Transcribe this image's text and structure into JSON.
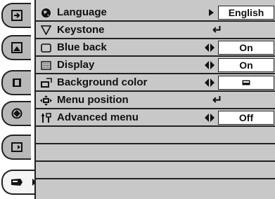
{
  "menu": {
    "tabs": [
      {
        "icon": "input-icon"
      },
      {
        "icon": "picture-adjust-icon"
      },
      {
        "icon": "screen-icon"
      },
      {
        "icon": "image-select-icon"
      },
      {
        "icon": "sound-icon"
      },
      {
        "icon": "setting-icon",
        "active": true
      }
    ],
    "items": [
      {
        "label": "Language",
        "icon": "globe-icon",
        "control": "submenu",
        "value": "English"
      },
      {
        "label": "Keystone",
        "icon": "keystone-icon",
        "control": "enter"
      },
      {
        "label": "Blue back",
        "icon": "blue-back-icon",
        "control": "toggle",
        "value": "On"
      },
      {
        "label": "Display",
        "icon": "display-icon",
        "control": "toggle",
        "value": "On"
      },
      {
        "label": "Background color",
        "icon": "background-color-icon",
        "control": "toggle",
        "value_icon": "color-swatch-icon"
      },
      {
        "label": "Menu position",
        "icon": "menu-position-icon",
        "control": "enter"
      },
      {
        "label": "Advanced menu",
        "icon": "advanced-menu-icon",
        "control": "toggle",
        "value": "Off"
      }
    ]
  }
}
